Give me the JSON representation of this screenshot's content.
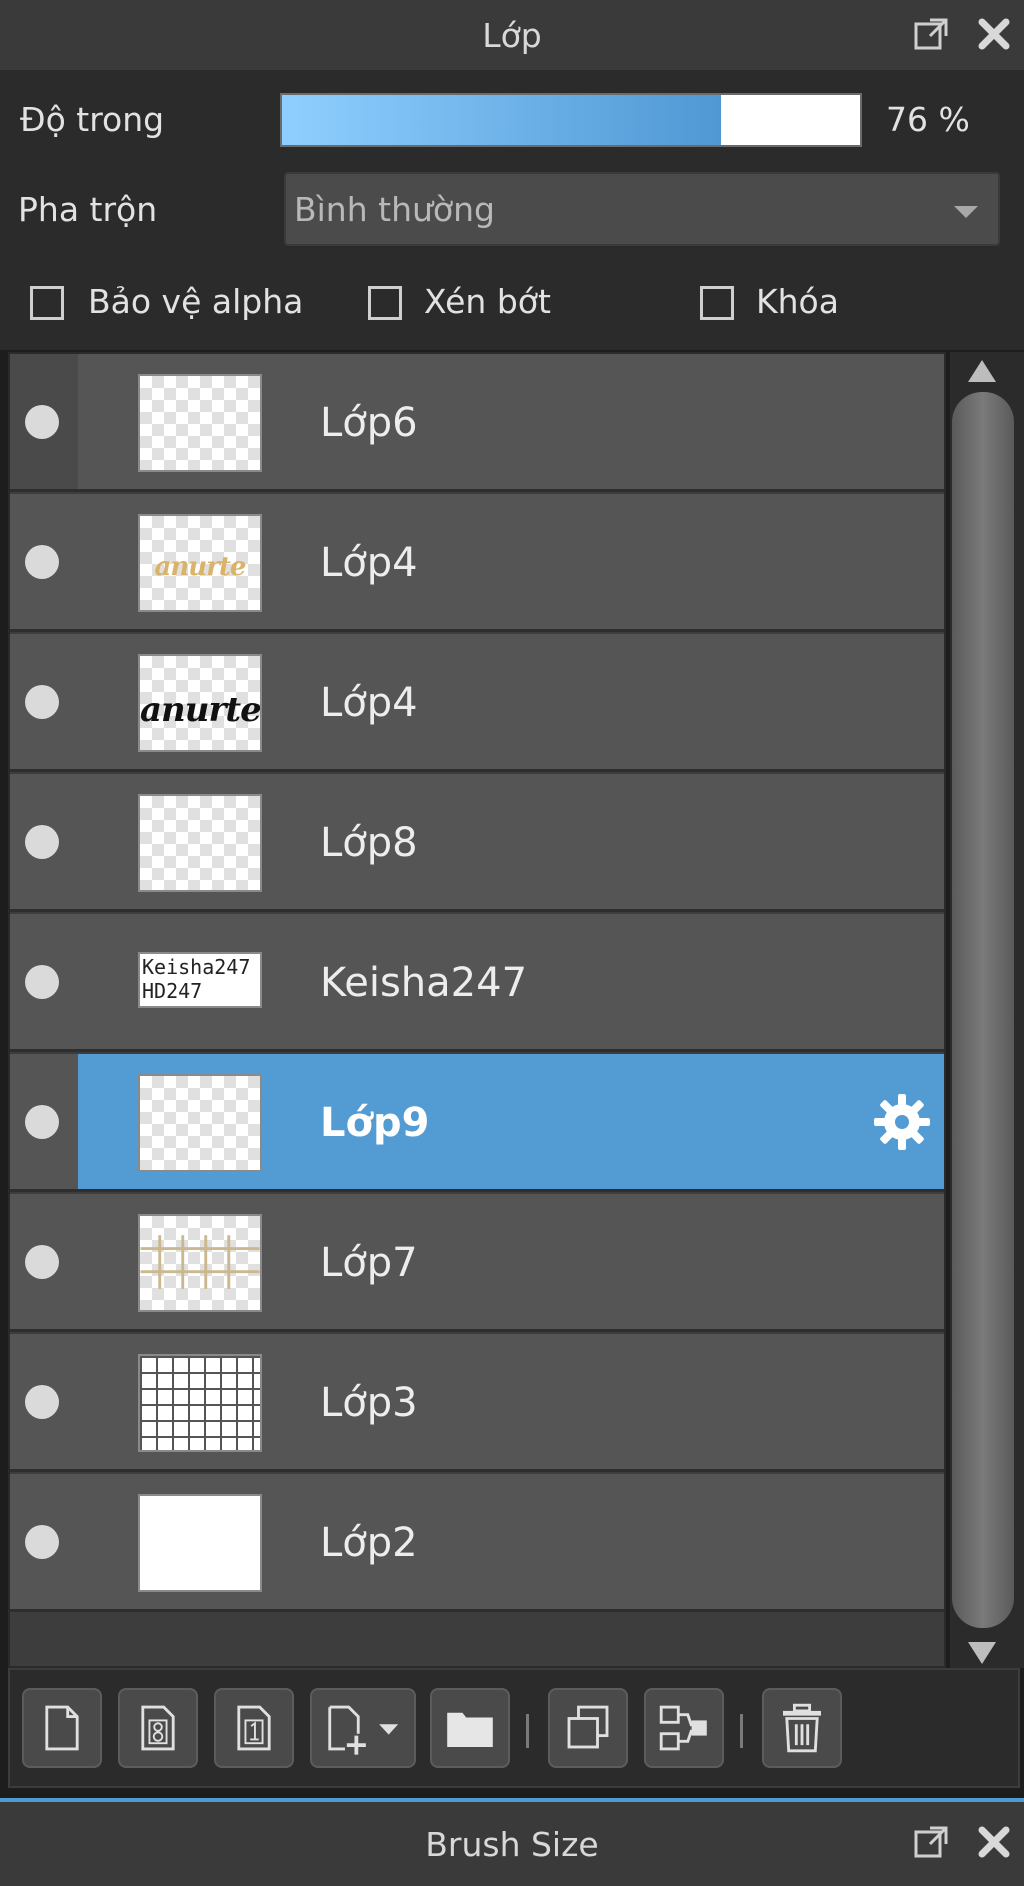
{
  "panel": {
    "title": "Lớp",
    "icons": {
      "popout": "popout-icon",
      "close": "close-icon"
    }
  },
  "opacity": {
    "label": "Độ trong",
    "value": 76,
    "display": "76 %"
  },
  "blend": {
    "label": "Pha trộn",
    "value": "Bình thường"
  },
  "options": {
    "protect_alpha": {
      "label": "Bảo vệ alpha",
      "checked": false
    },
    "clip": {
      "label": "Xén bớt",
      "checked": false
    },
    "lock": {
      "label": "Khóa",
      "checked": false
    }
  },
  "layers": [
    {
      "name": "Lớp6",
      "thumb": "blank"
    },
    {
      "name": "Lớp4",
      "thumb": "script-gold",
      "thumb_text": "anurte"
    },
    {
      "name": "Lớp4",
      "thumb": "script-black",
      "thumb_text": "anurte"
    },
    {
      "name": "Lớp8",
      "thumb": "blank"
    },
    {
      "name": "Keisha247",
      "thumb": "text",
      "thumb_text": [
        "Keisha247",
        "HD247"
      ]
    },
    {
      "name": "Lớp9",
      "thumb": "blank",
      "selected": true
    },
    {
      "name": "Lớp7",
      "thumb": "lines"
    },
    {
      "name": "Lớp3",
      "thumb": "grid"
    },
    {
      "name": "Lớp2",
      "thumb": "white"
    }
  ],
  "toolbar": {
    "buttons": [
      "new-layer-icon",
      "new-8bit-layer-icon",
      "new-1bit-layer-icon",
      "add-layer-menu-icon",
      "new-folder-icon",
      "duplicate-layer-icon",
      "merge-layer-icon",
      "delete-layer-icon"
    ]
  },
  "bottom_panel": {
    "title": "Brush Size"
  },
  "colors": {
    "accent": "#529bd3",
    "panel": "#2b2b2b",
    "row": "#555555",
    "titlebar": "#3a3a3a"
  }
}
